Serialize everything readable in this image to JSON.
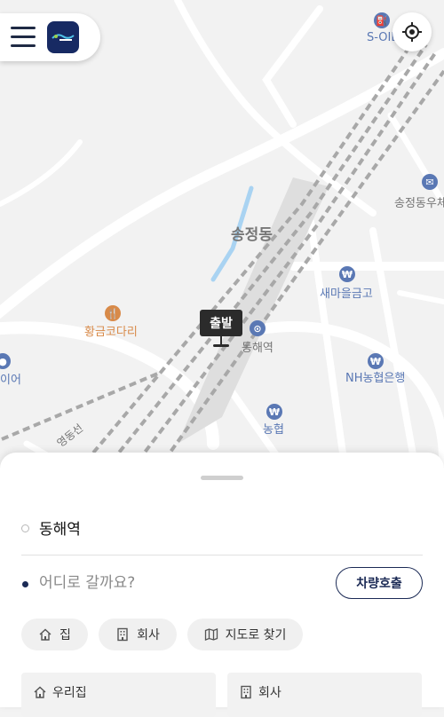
{
  "header": {
    "menu_icon": "hamburger-menu-icon",
    "logo_icon": "app-logo-icon",
    "locate_icon": "current-location-icon"
  },
  "map": {
    "labels": {
      "soil": "S-OIL",
      "songjeong_dong_big": "송정동",
      "songjeong_dong_right": "송정동우체",
      "saemaeul": "새마을금고",
      "hwanggeum": "황금코다리",
      "donghae_station": "동해역",
      "nh_bank": "NH농협은행",
      "nonghyup": "농협",
      "tire": "이어",
      "line": "영동선"
    },
    "start_marker": "출발",
    "colors": {
      "poi_blue": "#5a78b4",
      "food_orange": "#d88a49",
      "rail": "#9a9a9a"
    }
  },
  "sheet": {
    "origin": "동해역",
    "destination_placeholder": "어디로 갈까요?",
    "call_button": "차량호출",
    "chips": [
      {
        "label": "집",
        "icon": "home-icon"
      },
      {
        "label": "회사",
        "icon": "building-icon"
      },
      {
        "label": "지도로 찾기",
        "icon": "map-icon"
      }
    ],
    "saved": [
      {
        "label": "우리집",
        "icon": "home-icon"
      },
      {
        "label": "회사",
        "icon": "building-icon"
      }
    ],
    "accent_color": "#1b2a55"
  }
}
